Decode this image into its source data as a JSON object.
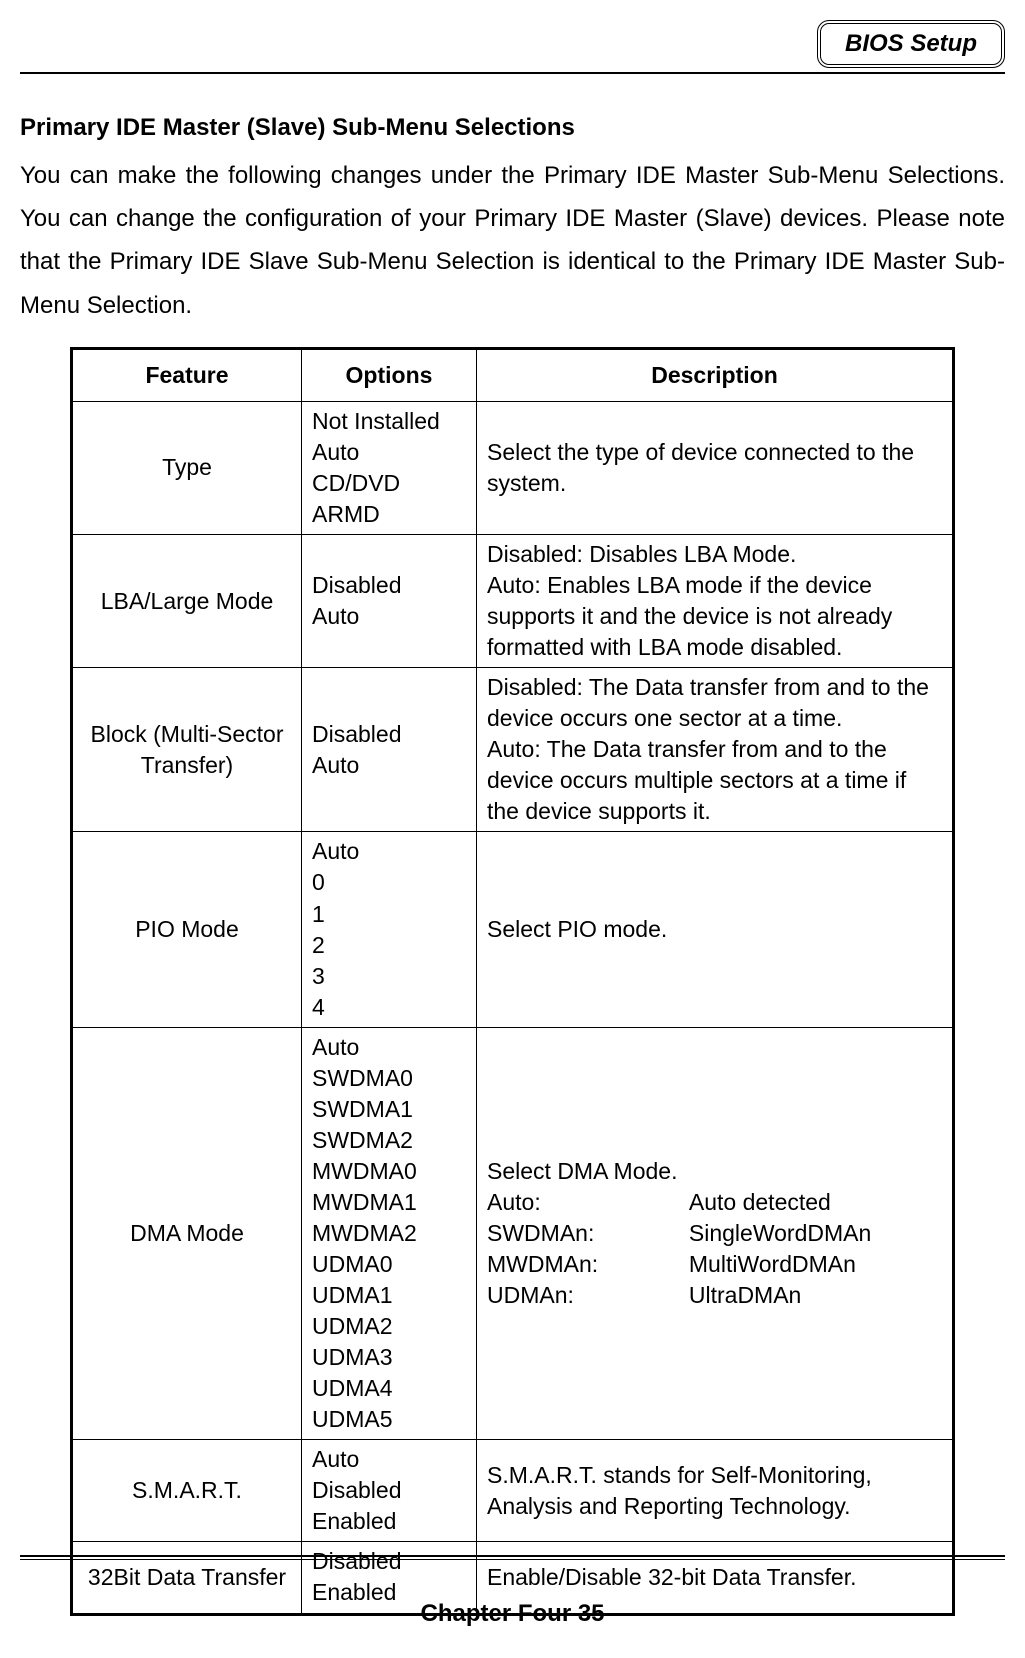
{
  "header": {
    "tag": "BIOS Setup"
  },
  "heading": "Primary IDE Master (Slave) Sub-Menu Selections",
  "intro": "You can make the following changes under the Primary IDE Master Sub-Menu Selections. You can change the configuration of your Primary IDE Master (Slave) devices. Please note that the Primary IDE Slave Sub-Menu Selection is identical to the Primary IDE Master Sub-Menu Selection.",
  "table": {
    "headers": {
      "feature": "Feature",
      "options": "Options",
      "description": "Description"
    },
    "rows": [
      {
        "feature": "Type",
        "options": "Not Installed\nAuto\nCD/DVD\nARMD",
        "description": "Select the type of device connected to the system."
      },
      {
        "feature": "LBA/Large Mode",
        "options": "Disabled\nAuto",
        "description": "Disabled: Disables LBA Mode.\nAuto: Enables LBA mode if the device supports it and the device is not already formatted with LBA mode disabled."
      },
      {
        "feature": "Block (Multi-Sector Transfer)",
        "options": "Disabled\nAuto",
        "description": "Disabled: The Data transfer from and to the device occurs one sector at a time.\nAuto: The Data transfer from and to the device occurs multiple sectors at a time if the device supports it."
      },
      {
        "feature": "PIO Mode",
        "options": "Auto\n0\n1\n2\n3\n4",
        "description": "Select PIO mode."
      },
      {
        "feature": "DMA Mode",
        "options": "Auto\nSWDMA0\nSWDMA1\nSWDMA2\nMWDMA0\nMWDMA1\nMWDMA2\nUDMA0\nUDMA1\nUDMA2\nUDMA3\nUDMA4\nUDMA5",
        "dma": {
          "intro": "Select DMA Mode.",
          "k1": "Auto:",
          "v1": "Auto detected",
          "k2": "SWDMAn:",
          "v2": "SingleWordDMAn",
          "k3": "MWDMAn:",
          "v3": "MultiWordDMAn",
          "k4": "UDMAn:",
          "v4": "UltraDMAn"
        }
      },
      {
        "feature": "S.M.A.R.T.",
        "options": "Auto\nDisabled\nEnabled",
        "description": "S.M.A.R.T. stands for Self-Monitoring, Analysis and Reporting Technology."
      },
      {
        "feature": "32Bit Data Transfer",
        "options": "Disabled\nEnabled",
        "description": "Enable/Disable 32-bit Data Transfer."
      }
    ]
  },
  "footer": "Chapter Four 35"
}
